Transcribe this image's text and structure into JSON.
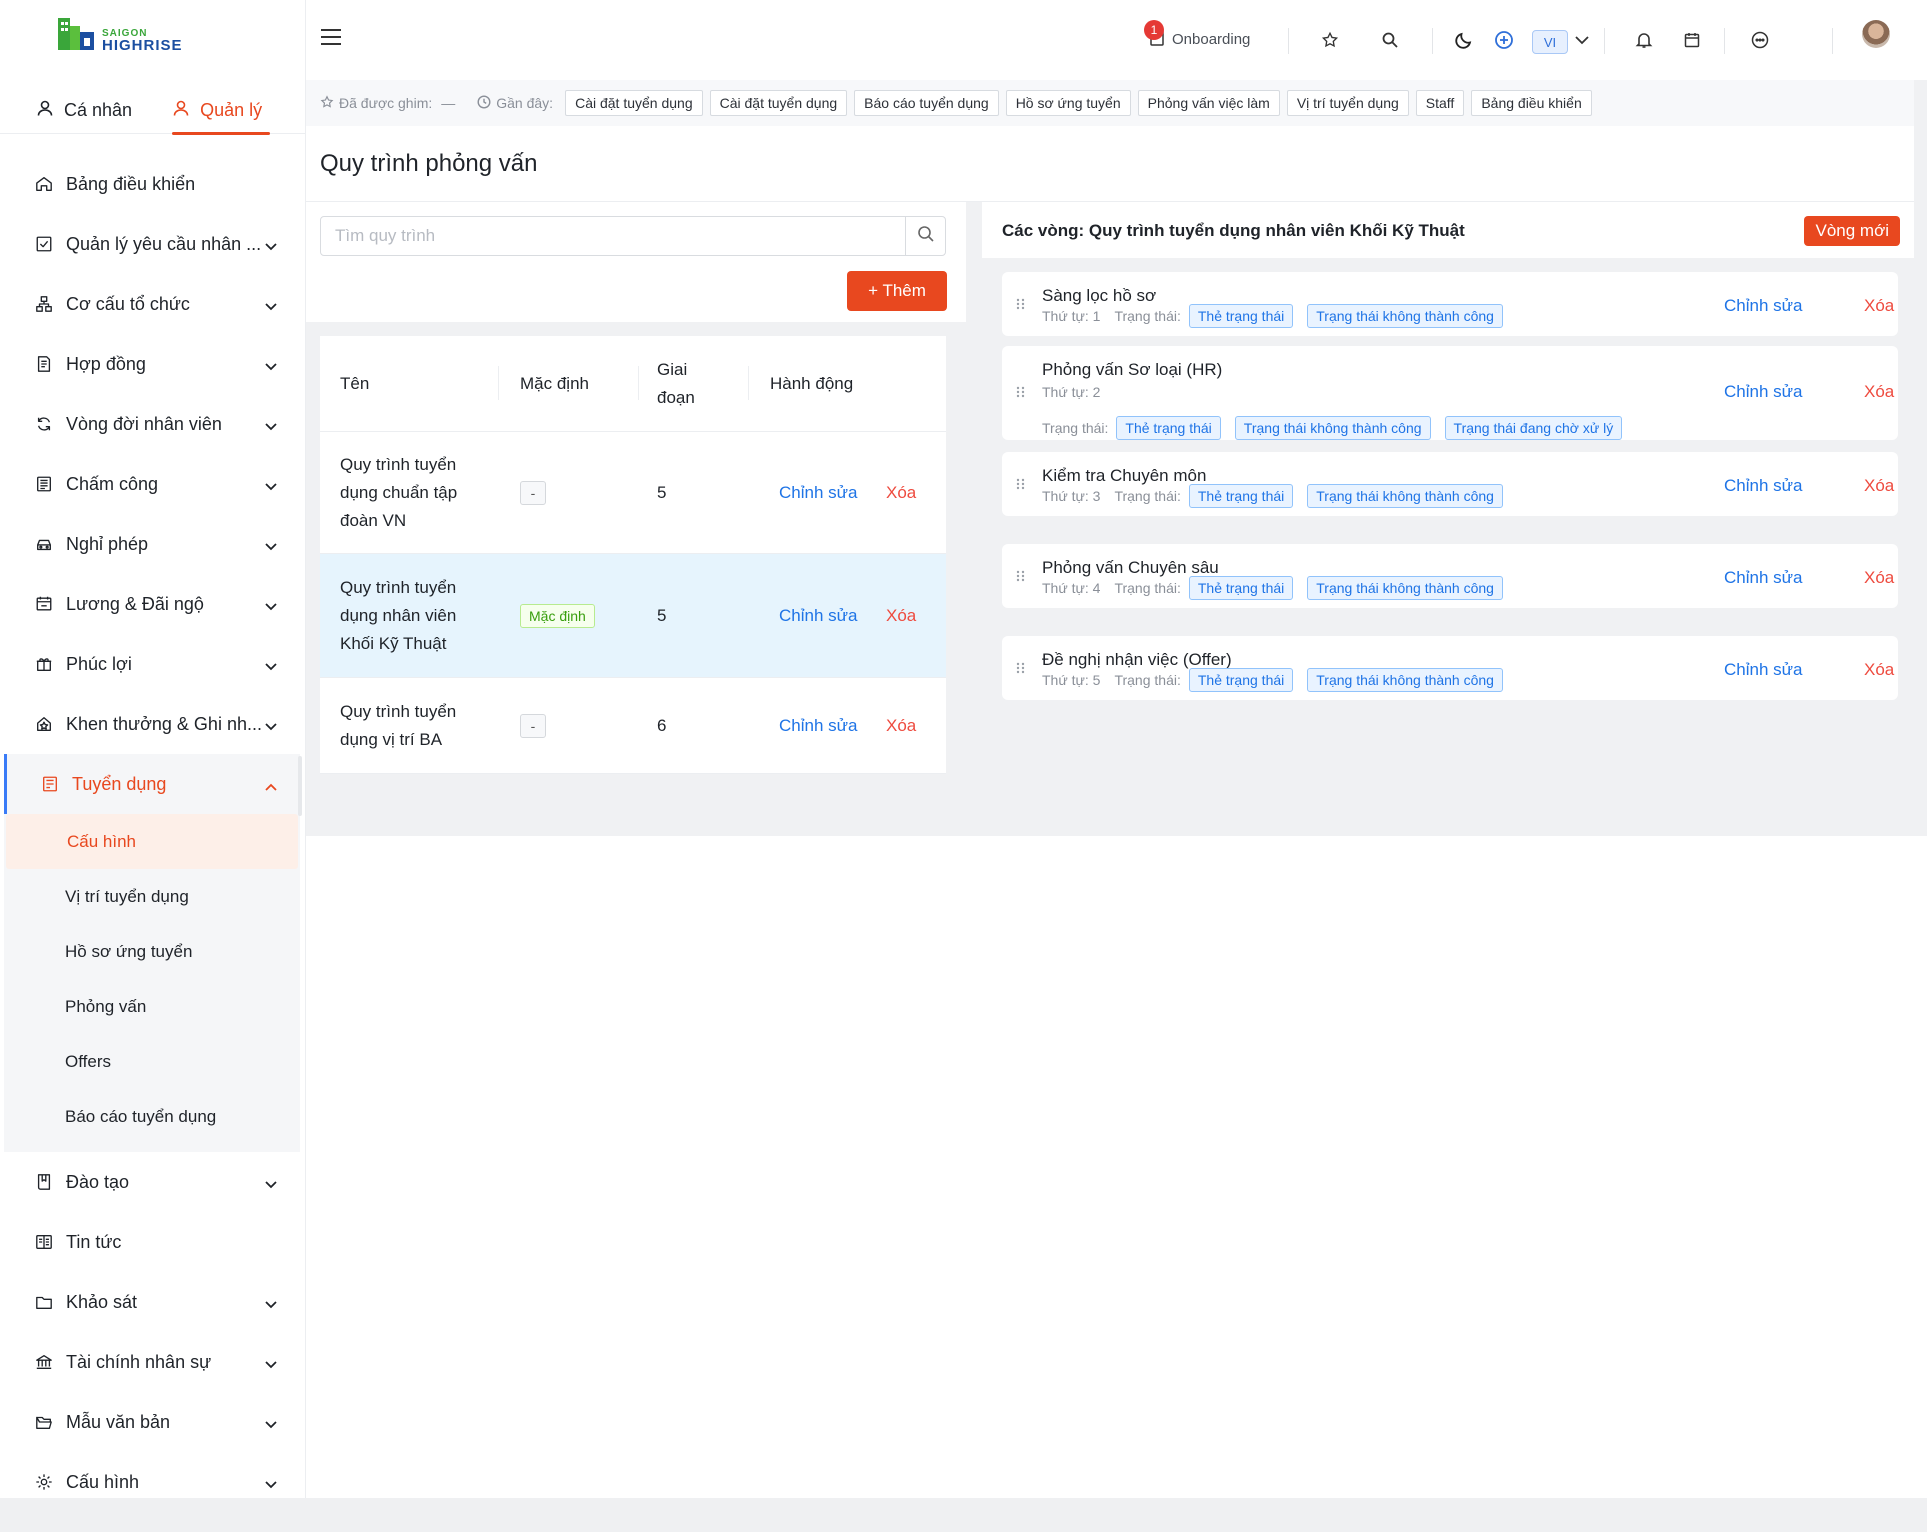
{
  "brand": {
    "line1": "SAIGON",
    "line2": "HIGHRISE",
    "green": "#3aa63a",
    "blue": "#1c4fa1"
  },
  "accent": "#e8481f",
  "sidebar": {
    "tabs": [
      {
        "label": "Cá nhân",
        "icon": "user-icon"
      },
      {
        "label": "Quản lý",
        "icon": "user-icon"
      }
    ],
    "items": [
      {
        "label": "Bảng điều khiển",
        "icon": "home-icon",
        "has_children": false
      },
      {
        "label": "Quản lý yêu cầu nhân ...",
        "icon": "checkbox-icon",
        "has_children": true
      },
      {
        "label": "Cơ cấu tổ chức",
        "icon": "org-chart-icon",
        "has_children": true
      },
      {
        "label": "Hợp đồng",
        "icon": "contract-icon",
        "has_children": true
      },
      {
        "label": "Vòng đời nhân viên",
        "icon": "cycle-icon",
        "has_children": true
      },
      {
        "label": "Chấm công",
        "icon": "timesheet-icon",
        "has_children": true
      },
      {
        "label": "Nghỉ phép",
        "icon": "car-icon",
        "has_children": true
      },
      {
        "label": "Lương & Đãi ngộ",
        "icon": "calendar-money-icon",
        "has_children": true
      },
      {
        "label": "Phúc lợi",
        "icon": "gift-icon",
        "has_children": true
      },
      {
        "label": "Khen thưởng & Ghi nh...",
        "icon": "award-icon",
        "has_children": true
      },
      {
        "label": "Tuyển dụng",
        "icon": "recruit-icon",
        "has_children": true,
        "open": true
      }
    ],
    "recruit_sub": [
      "Cấu hình",
      "Vị trí tuyển dụng",
      "Hồ sơ ứng tuyển",
      "Phỏng vấn",
      "Offers",
      "Báo cáo tuyển dụng"
    ],
    "items_after": [
      {
        "label": "Đào tạo",
        "icon": "book-icon",
        "has_children": true
      },
      {
        "label": "Tin tức",
        "icon": "news-icon",
        "has_children": false
      },
      {
        "label": "Khảo sát",
        "icon": "folder-icon",
        "has_children": true
      },
      {
        "label": "Tài chính nhân sự",
        "icon": "bank-icon",
        "has_children": true
      },
      {
        "label": "Mẫu văn bản",
        "icon": "folder-open-icon",
        "has_children": true
      },
      {
        "label": "Cấu hình",
        "icon": "settings-icon",
        "has_children": true
      }
    ]
  },
  "topbar": {
    "onboarding_label": "Onboarding",
    "onboarding_badge": "1",
    "language": "VI"
  },
  "pins": {
    "pinned_label": "Đã được ghim:",
    "pinned_value": "—",
    "recent_label": "Gần đây:",
    "recent": [
      "Cài đặt tuyển dụng",
      "Cài đặt tuyển dụng",
      "Báo cáo tuyển dụng",
      "Hồ sơ ứng tuyển",
      "Phỏng vấn việc làm",
      "Vị trí tuyển dụng",
      "Staff",
      "Bảng điều khiển"
    ]
  },
  "page": {
    "title": "Quy trình phỏng vấn",
    "search_placeholder": "Tìm quy trình",
    "add_label": "+ Thêm"
  },
  "table": {
    "headers": {
      "name": "Tên",
      "default": "Mặc định",
      "stage": "Giai đoạn",
      "action": "Hành động"
    },
    "rows": [
      {
        "name": "Quy trình tuyển dụng chuẩn tập đoàn VN",
        "default": "-",
        "is_default": false,
        "stages": "5",
        "edit": "Chỉnh sửa",
        "delete": "Xóa"
      },
      {
        "name": "Quy trình tuyển dụng nhân viên Khối Kỹ Thuật",
        "default": "Mặc định",
        "is_default": true,
        "stages": "5",
        "edit": "Chỉnh sửa",
        "delete": "Xóa",
        "selected": true
      },
      {
        "name": "Quy trình tuyển dụng vị trí BA",
        "default": "-",
        "is_default": false,
        "stages": "6",
        "edit": "Chỉnh sửa",
        "delete": "Xóa"
      }
    ]
  },
  "rounds_panel": {
    "title": "Các vòng: Quy trình tuyển dụng nhân viên Khối Kỹ Thuật",
    "new_label": "Vòng mới",
    "order_label": "Thứ tự:",
    "status_label": "Trạng thái:",
    "edit_label": "Chỉnh sửa",
    "delete_label": "Xóa",
    "rounds": [
      {
        "name": "Sàng lọc hồ sơ",
        "order": "1",
        "tags": [
          "Thẻ trạng thái",
          "Trạng thái không thành công"
        ]
      },
      {
        "name": "Phỏng vấn Sơ loại (HR)",
        "order": "2",
        "tags": [
          "Thẻ trạng thái",
          "Trạng thái không thành công",
          "Trạng thái đang chờ xử lý"
        ]
      },
      {
        "name": "Kiểm tra Chuyên môn",
        "order": "3",
        "tags": [
          "Thẻ trạng thái",
          "Trạng thái không thành công"
        ]
      },
      {
        "name": "Phỏng vấn Chuyên sâu",
        "order": "4",
        "tags": [
          "Thẻ trạng thái",
          "Trạng thái không thành công"
        ]
      },
      {
        "name": "Đề nghị nhận việc (Offer)",
        "order": "5",
        "tags": [
          "Thẻ trạng thái",
          "Trạng thái không thành công"
        ]
      }
    ]
  }
}
